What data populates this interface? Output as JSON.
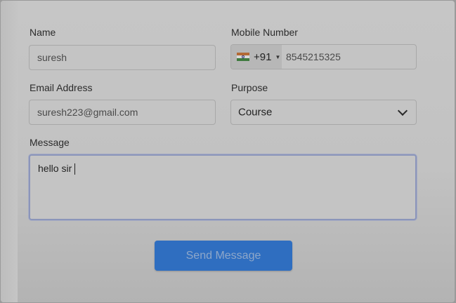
{
  "form": {
    "name": {
      "label": "Name",
      "value": "suresh"
    },
    "mobile": {
      "label": "Mobile Number",
      "country_code": "+91",
      "value": "8545215325",
      "flag": "india-flag-icon"
    },
    "email": {
      "label": "Email Address",
      "value": "suresh223@gmail.com"
    },
    "purpose": {
      "label": "Purpose",
      "selected": "Course"
    },
    "message": {
      "label": "Message",
      "value": "hello sir"
    },
    "submit_label": "Send Message"
  },
  "colors": {
    "button": "#2f6ec0",
    "focus_border": "#8b95ba"
  }
}
